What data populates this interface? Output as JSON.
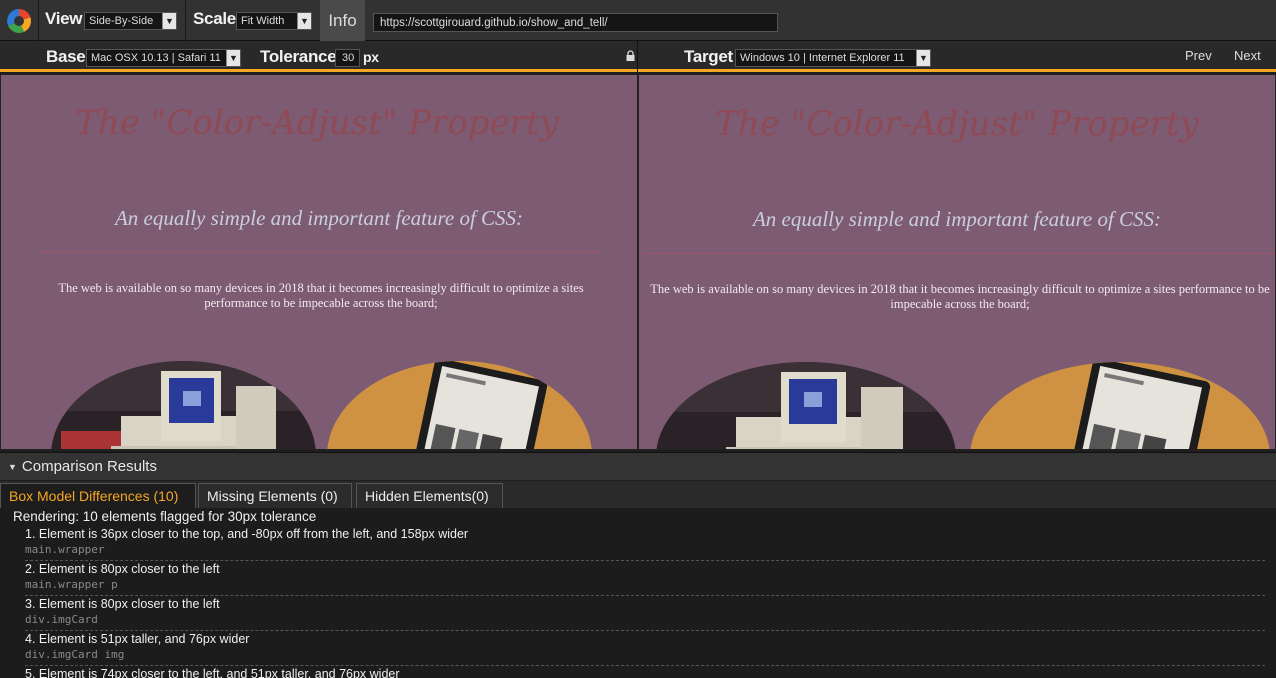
{
  "toolbar": {
    "view_label": "View",
    "view_value": "Side-By-Side",
    "scale_label": "Scale",
    "scale_value": "Fit Width",
    "info_label": "Info",
    "url": "https://scottgirouard.github.io/show_and_tell/"
  },
  "compare_bar": {
    "base_label": "Base",
    "base_value": "Mac OSX 10.13 | Safari 11",
    "tolerance_label": "Tolerance",
    "tolerance_value": "30",
    "tolerance_unit": "px",
    "target_label": "Target",
    "target_value": "Windows 10 | Internet Explorer 11",
    "prev_label": "Prev",
    "next_label": "Next"
  },
  "page": {
    "heading": "The \"Color-Adjust\" Property",
    "subheading": "An equally simple and important feature of CSS:",
    "paragraph_base": "The web is available on so many devices in 2018 that it becomes increasingly difficult to optimize a sites performance to be impecable across the board;",
    "paragraph_target": "The web is available on so many devices in 2018 that it becomes increasingly difficult to optimize a sites performance to be impecable across the board;",
    "colors": {
      "background": "#7d5b72",
      "heading": "#8f4a55",
      "subheading": "#c9cfdc"
    }
  },
  "results": {
    "title": "Comparison Results",
    "tabs": [
      {
        "label": "Box Model Differences (10)",
        "active": true
      },
      {
        "label": "Missing Elements (0)",
        "active": false
      },
      {
        "label": "Hidden Elements(0)",
        "active": false
      }
    ],
    "rendering": "Rendering: 10 elements flagged for 30px tolerance",
    "items": [
      {
        "desc": "1. Element is 36px closer to the top, and -80px off from the left, and 158px wider",
        "selector": "main.wrapper"
      },
      {
        "desc": "2. Element is 80px closer to the left",
        "selector": "main.wrapper p"
      },
      {
        "desc": "3. Element is 80px closer to the left",
        "selector": "div.imgCard"
      },
      {
        "desc": "4. Element is 51px taller, and 76px wider",
        "selector": "div.imgCard img"
      },
      {
        "desc": "5. Element is 74px closer to the left, and 51px taller, and 76px wider",
        "selector": ""
      }
    ]
  },
  "accent_color": "#f5a623"
}
